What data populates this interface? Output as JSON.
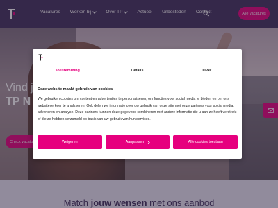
{
  "header": {
    "nav": [
      {
        "label": "Vacatures",
        "has_dropdown": false
      },
      {
        "label": "Werken bij",
        "has_dropdown": true
      },
      {
        "label": "Over TP",
        "has_dropdown": true
      },
      {
        "label": "Actueel",
        "has_dropdown": false
      },
      {
        "label": "Uitbesteden",
        "has_dropdown": false
      },
      {
        "label": "Contact",
        "has_dropdown": false
      }
    ],
    "cta_label": "Alle vacatures"
  },
  "hero": {
    "title_line1": "Vind j",
    "title_line2": "TP N",
    "button_label": "Check vacatures"
  },
  "band": {
    "text_pre": "Match ",
    "text_bold": "jouw wensen",
    "text_post": " met ons aanbod"
  },
  "cookie_modal": {
    "tabs": [
      {
        "label": "Toestemming",
        "active": true
      },
      {
        "label": "Details",
        "active": false
      },
      {
        "label": "Over",
        "active": false
      }
    ],
    "heading": "Deze website maakt gebruik van cookies",
    "body": "We gebruiken cookies om content en advertenties te personaliseren, om functies voor social media te bieden en om ons websiteverkeer te analyseren. Ook delen we informatie over uw gebruik van onze site met onze partners voor social media, adverteren en analyse. Deze partners kunnen deze gegevens combineren met andere informatie die u aan ze heeft verstrekt of die ze hebben verzameld op basis van uw gebruik van hun services.",
    "buttons": {
      "reject": "Weigeren",
      "customize": "Aanpassen",
      "accept_all": "Alle cookies toestaan"
    }
  },
  "colors": {
    "header_bg": "#41305e",
    "accent": "#e6007e",
    "band_bg": "#e8e4f2"
  }
}
